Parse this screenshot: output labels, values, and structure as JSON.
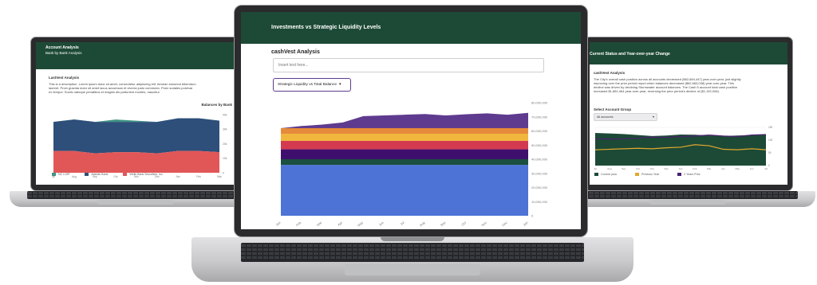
{
  "colors": {
    "brand_green": "#1d4a36",
    "accent_purple": "#5f3b8f"
  },
  "left_laptop": {
    "app_title": "Account Analysis",
    "app_subtitle": "Bank by Bank Analysis",
    "section_heading": "LastVest Analysis",
    "description": "This is a description. Lorem ipsum dolor sit amet, consectetur adipiscing elit. Aenean euismod bibendum laoreet. Proin gravida dolor sit amet lacus accumsan et viverra justo commodo. Proin sodales pulvinar ex tempor. Sociis natoque penatibus et magnis dis parturient montes, nascetur",
    "chart_title": "Balances by Bank",
    "legend": [
      {
        "label": "NC LGIP",
        "color": "#3f9484"
      },
      {
        "label": "Atlantic Bank",
        "color": "#2e4f7a"
      },
      {
        "label": "Wells Bank Securities, Inc",
        "color": "#e15757"
      }
    ]
  },
  "center_laptop": {
    "app_title": "Investments vs Strategic Liquidity Levels",
    "section_heading": "cashVest Analysis",
    "search_placeholder": "Insert text here...",
    "dropdown_selected": "Strategic Liquidity vs Total Balance"
  },
  "right_laptop": {
    "app_title": "Current Status and Year-over-year Change",
    "section_heading": "cashVest Analysis",
    "description": "The City's overall cash position across all accounts decreased ($62,684,447) year-over-year, just slightly improving over the prior period report when balances decreased ($62,683,038) year-over-year. This decline was driven by declining Stormwater account balances. The Cash 5 account total cash position increased $1,881,464 year-over-year, reversing the prior period's decline of ($1,192,006).",
    "select_label": "Select Account Group",
    "select_value": "All accounts",
    "legend": [
      {
        "label": "Current year",
        "color": "#1d4a36"
      },
      {
        "label": "Previous Year",
        "color": "#e0a82e"
      },
      {
        "label": "2 Years Prior",
        "color": "#4b2170"
      }
    ]
  },
  "chart_data": [
    {
      "type": "area",
      "title": "Balances by Bank",
      "series": [
        {
          "name": "NC LGIP",
          "values": [
            [
              42,
              40
            ],
            [
              42,
              40
            ],
            [
              42,
              40
            ],
            [
              44,
              40
            ],
            [
              43,
              40
            ],
            [
              42,
              40
            ],
            [
              41,
              40
            ],
            [
              43,
              40
            ],
            [
              42,
              40
            ]
          ]
        },
        {
          "name": "Atlantic Bank",
          "values": [
            24,
            26,
            26,
            25,
            25,
            26,
            27,
            27,
            26
          ]
        },
        {
          "name": "Wells Bank Securities, Inc",
          "values": [
            18,
            18,
            16,
            17,
            17,
            16,
            18,
            18,
            17
          ]
        }
      ],
      "x": [
        "Jul",
        "Aug",
        "Sep",
        "Oct",
        "Nov",
        "Dec",
        "Jan",
        "Feb",
        "Mar"
      ]
    },
    {
      "type": "area",
      "title": "Strategic Liquidity vs Total Balance",
      "x": [
        "Jan",
        "Feb",
        "Mar",
        "Apr",
        "May",
        "Jun",
        "Jul",
        "Aug",
        "Sep",
        "Oct",
        "Nov",
        "Dec",
        "Jan"
      ],
      "bands": [
        {
          "name": "band-blue",
          "color": "#4d73d6",
          "from": 0,
          "to": 36000000
        },
        {
          "name": "band-green",
          "color": "#1b4f3f",
          "from": 36000000,
          "to": 40000000
        },
        {
          "name": "band-indigo",
          "color": "#3f0f6e",
          "from": 40000000,
          "to": 47000000
        },
        {
          "name": "band-red",
          "color": "#d33a50",
          "from": 47000000,
          "to": 53000000
        },
        {
          "name": "band-yellow",
          "color": "#f1b63c",
          "from": 53000000,
          "to": 58000000
        },
        {
          "name": "band-orange",
          "color": "#e58a3a",
          "from": 58000000,
          "to": 62000000
        }
      ],
      "total_balance": [
        62000000,
        63500000,
        64500000,
        66000000,
        70500000,
        71000000,
        71500000,
        72000000,
        71000000,
        71800000,
        72500000,
        71500000,
        72800000
      ],
      "y_ticks": [
        "0",
        "10,000,000",
        "20,000,000",
        "30,000,000",
        "40,000,000",
        "50,000,000",
        "60,000,000",
        "70,000,000",
        "80,000,000"
      ],
      "ylim": [
        0,
        80000000
      ]
    },
    {
      "type": "line",
      "title": "Current Status and Year-over-year Change",
      "series": [
        {
          "name": "Current year",
          "values": [
            128,
            126,
            124,
            120,
            116,
            118,
            122,
            121,
            118,
            116,
            118,
            120,
            121
          ]
        },
        {
          "name": "Previous Year",
          "values": [
            62,
            64,
            66,
            68,
            66,
            70,
            72,
            82,
            78,
            64,
            62,
            66,
            62
          ]
        },
        {
          "name": "2 Years Prior",
          "values": [
            106,
            104,
            106,
            108,
            112,
            110,
            114,
            116,
            120,
            116,
            114,
            120,
            122
          ]
        }
      ],
      "x": [
        "Jul",
        "Aug",
        "Sep",
        "Oct",
        "Nov",
        "Dec",
        "Jan",
        "Feb",
        "Mar",
        "Apr",
        "May",
        "Jun",
        "Jul"
      ],
      "ylim": [
        0,
        150
      ]
    }
  ]
}
